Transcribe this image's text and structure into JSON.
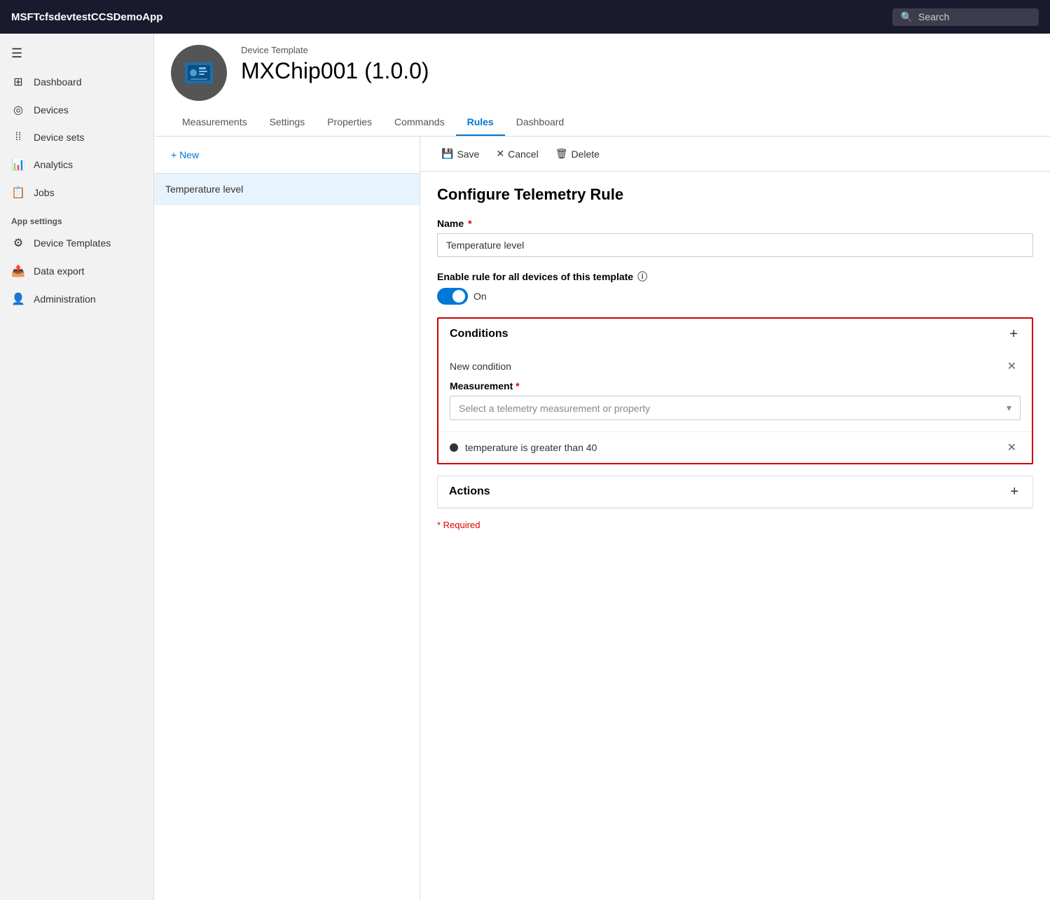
{
  "app": {
    "title": "MSFTcfsdevtestCCSDemoApp",
    "search_placeholder": "Search"
  },
  "sidebar": {
    "hamburger_label": "☰",
    "items": [
      {
        "id": "dashboard",
        "label": "Dashboard",
        "icon": "⊞"
      },
      {
        "id": "devices",
        "label": "Devices",
        "icon": "◎"
      },
      {
        "id": "device-sets",
        "label": "Device sets",
        "icon": "⁞⁞"
      },
      {
        "id": "analytics",
        "label": "Analytics",
        "icon": "📊"
      },
      {
        "id": "jobs",
        "label": "Jobs",
        "icon": "📋"
      }
    ],
    "app_settings_label": "App settings",
    "app_settings_items": [
      {
        "id": "device-templates",
        "label": "Device Templates",
        "icon": "⚙"
      },
      {
        "id": "data-export",
        "label": "Data export",
        "icon": "📤"
      },
      {
        "id": "administration",
        "label": "Administration",
        "icon": "👤"
      }
    ]
  },
  "device_header": {
    "template_label": "Device Template",
    "device_name": "MXChip001  (1.0.0)",
    "tabs": [
      {
        "id": "measurements",
        "label": "Measurements"
      },
      {
        "id": "settings",
        "label": "Settings"
      },
      {
        "id": "properties",
        "label": "Properties"
      },
      {
        "id": "commands",
        "label": "Commands"
      },
      {
        "id": "rules",
        "label": "Rules",
        "active": true
      },
      {
        "id": "dashboard",
        "label": "Dashboard"
      }
    ]
  },
  "rules_panel": {
    "new_button": "+ New",
    "items": [
      {
        "id": "temp-level",
        "label": "Temperature level"
      }
    ]
  },
  "configure_panel": {
    "toolbar": {
      "save_label": "Save",
      "cancel_label": "Cancel",
      "delete_label": "Delete"
    },
    "title": "Configure Telemetry Rule",
    "name_label": "Name",
    "name_value": "Temperature level",
    "enable_label": "Enable rule for all devices of this template",
    "toggle_state": "On",
    "conditions_label": "Conditions",
    "new_condition_label": "New condition",
    "measurement_label": "Measurement",
    "measurement_placeholder": "Select a telemetry measurement or property",
    "condition_summary": "temperature is greater than 40",
    "actions_label": "Actions",
    "required_note": "* Required"
  }
}
